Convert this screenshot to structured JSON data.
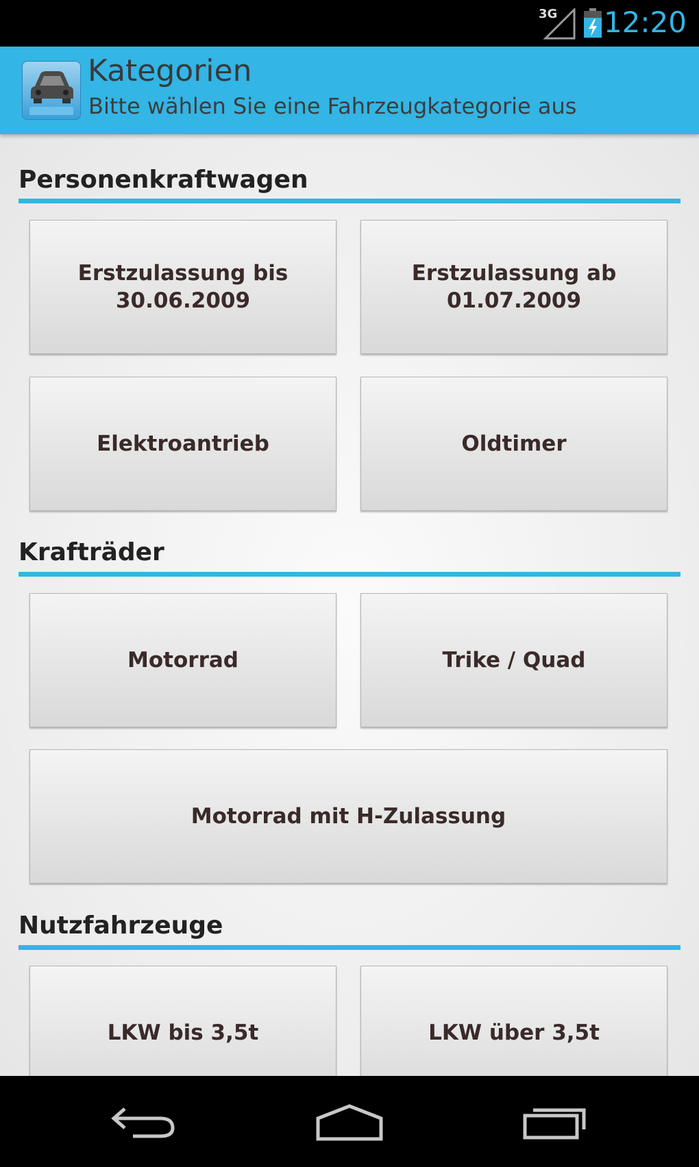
{
  "status_bar": {
    "network": "3G",
    "time": "12:20",
    "icons": [
      "signal-icon",
      "battery-charging-icon"
    ]
  },
  "action_bar": {
    "app_icon": "car-app-icon",
    "title": "Kategorien",
    "subtitle": "Bitte wählen Sie eine Fahrzeugkategorie aus"
  },
  "sections": [
    {
      "title": "Personenkraftwagen",
      "buttons": [
        "Erstzulassung bis\n30.06.2009",
        "Erstzulassung ab\n01.07.2009",
        "Elektroantrieb",
        "Oldtimer"
      ]
    },
    {
      "title": "Krafträder",
      "buttons": [
        "Motorrad",
        "Trike / Quad",
        "Motorrad mit H-Zulassung"
      ]
    },
    {
      "title": "Nutzfahrzeuge",
      "buttons": [
        "LKW bis 3,5t",
        "LKW über 3,5t"
      ]
    }
  ],
  "nav_bar": {
    "icons": [
      "back-icon",
      "home-icon",
      "recent-apps-icon"
    ]
  },
  "colors": {
    "accent": "#33b5e5",
    "background": "#efefef",
    "tile_text": "#3a2a2a"
  }
}
